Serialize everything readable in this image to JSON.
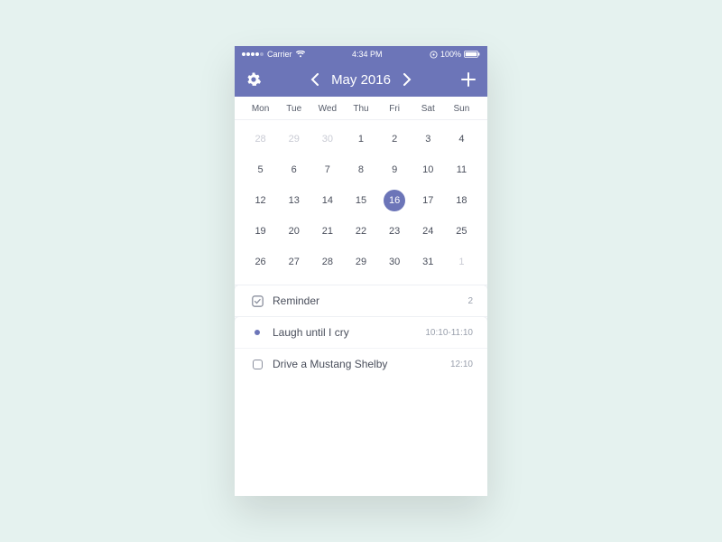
{
  "colors": {
    "accent": "#6c75b8"
  },
  "status": {
    "carrier": "Carrier",
    "time": "4:34 PM",
    "battery": "100%"
  },
  "header": {
    "title": "May 2016"
  },
  "weekdays": [
    "Mon",
    "Tue",
    "Wed",
    "Thu",
    "Fri",
    "Sat",
    "Sun"
  ],
  "days": [
    {
      "n": "28",
      "other": true
    },
    {
      "n": "29",
      "other": true
    },
    {
      "n": "30",
      "other": true
    },
    {
      "n": "1"
    },
    {
      "n": "2"
    },
    {
      "n": "3"
    },
    {
      "n": "4"
    },
    {
      "n": "5"
    },
    {
      "n": "6"
    },
    {
      "n": "7"
    },
    {
      "n": "8"
    },
    {
      "n": "9"
    },
    {
      "n": "10"
    },
    {
      "n": "11"
    },
    {
      "n": "12"
    },
    {
      "n": "13"
    },
    {
      "n": "14"
    },
    {
      "n": "15"
    },
    {
      "n": "16",
      "sel": true
    },
    {
      "n": "17"
    },
    {
      "n": "18"
    },
    {
      "n": "19"
    },
    {
      "n": "20"
    },
    {
      "n": "21"
    },
    {
      "n": "22"
    },
    {
      "n": "23"
    },
    {
      "n": "24"
    },
    {
      "n": "25"
    },
    {
      "n": "26"
    },
    {
      "n": "27"
    },
    {
      "n": "28"
    },
    {
      "n": "29"
    },
    {
      "n": "30"
    },
    {
      "n": "31"
    },
    {
      "n": "1",
      "other": true
    }
  ],
  "reminder": {
    "label": "Reminder",
    "count": "2"
  },
  "events": [
    {
      "icon": "dot",
      "title": "Laugh until I cry",
      "meta": "10:10-11:10"
    },
    {
      "icon": "checkbox",
      "title": "Drive a Mustang Shelby",
      "meta": "12:10"
    }
  ]
}
